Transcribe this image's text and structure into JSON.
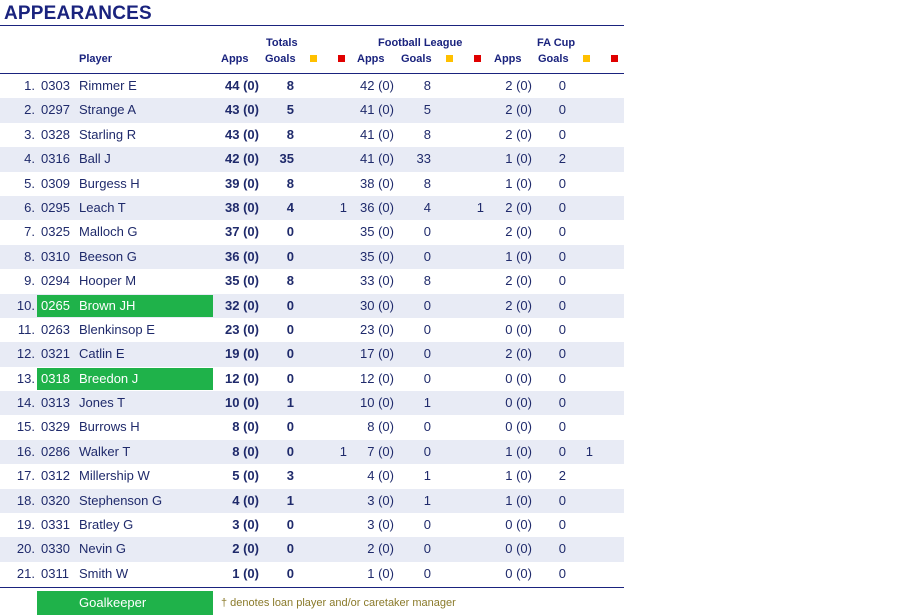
{
  "title": "APPEARANCES",
  "headers": {
    "player": "Player",
    "totals": "Totals",
    "football_league": "Football League",
    "fa_cup": "FA Cup",
    "apps": "Apps",
    "goals": "Goals"
  },
  "colors": {
    "goalkeeper": "#1fb24a",
    "yellow_card": "#ffc000",
    "red_card": "#e00000",
    "text": "#1a237e"
  },
  "rows": [
    {
      "pos": "1.",
      "code": "0303",
      "name": "Rimmer E",
      "gk": false,
      "tot_apps": "44 (0)",
      "tot_goals": "8",
      "tot_yel": "",
      "fl_apps": "42 (0)",
      "fl_goals": "8",
      "fl_yel": "",
      "fa_apps": "2 (0)",
      "fa_goals": "0",
      "fa_yel": ""
    },
    {
      "pos": "2.",
      "code": "0297",
      "name": "Strange A",
      "gk": false,
      "tot_apps": "43 (0)",
      "tot_goals": "5",
      "tot_yel": "",
      "fl_apps": "41 (0)",
      "fl_goals": "5",
      "fl_yel": "",
      "fa_apps": "2 (0)",
      "fa_goals": "0",
      "fa_yel": ""
    },
    {
      "pos": "3.",
      "code": "0328",
      "name": "Starling R",
      "gk": false,
      "tot_apps": "43 (0)",
      "tot_goals": "8",
      "tot_yel": "",
      "fl_apps": "41 (0)",
      "fl_goals": "8",
      "fl_yel": "",
      "fa_apps": "2 (0)",
      "fa_goals": "0",
      "fa_yel": ""
    },
    {
      "pos": "4.",
      "code": "0316",
      "name": "Ball J",
      "gk": false,
      "tot_apps": "42 (0)",
      "tot_goals": "35",
      "tot_yel": "",
      "fl_apps": "41 (0)",
      "fl_goals": "33",
      "fl_yel": "",
      "fa_apps": "1 (0)",
      "fa_goals": "2",
      "fa_yel": ""
    },
    {
      "pos": "5.",
      "code": "0309",
      "name": "Burgess H",
      "gk": false,
      "tot_apps": "39 (0)",
      "tot_goals": "8",
      "tot_yel": "",
      "fl_apps": "38 (0)",
      "fl_goals": "8",
      "fl_yel": "",
      "fa_apps": "1 (0)",
      "fa_goals": "0",
      "fa_yel": ""
    },
    {
      "pos": "6.",
      "code": "0295",
      "name": "Leach T",
      "gk": false,
      "tot_apps": "38 (0)",
      "tot_goals": "4",
      "tot_yel": "1",
      "fl_apps": "36 (0)",
      "fl_goals": "4",
      "fl_yel": "1",
      "fa_apps": "2 (0)",
      "fa_goals": "0",
      "fa_yel": ""
    },
    {
      "pos": "7.",
      "code": "0325",
      "name": "Malloch G",
      "gk": false,
      "tot_apps": "37 (0)",
      "tot_goals": "0",
      "tot_yel": "",
      "fl_apps": "35 (0)",
      "fl_goals": "0",
      "fl_yel": "",
      "fa_apps": "2 (0)",
      "fa_goals": "0",
      "fa_yel": ""
    },
    {
      "pos": "8.",
      "code": "0310",
      "name": "Beeson G",
      "gk": false,
      "tot_apps": "36 (0)",
      "tot_goals": "0",
      "tot_yel": "",
      "fl_apps": "35 (0)",
      "fl_goals": "0",
      "fl_yel": "",
      "fa_apps": "1 (0)",
      "fa_goals": "0",
      "fa_yel": ""
    },
    {
      "pos": "9.",
      "code": "0294",
      "name": "Hooper M",
      "gk": false,
      "tot_apps": "35 (0)",
      "tot_goals": "8",
      "tot_yel": "",
      "fl_apps": "33 (0)",
      "fl_goals": "8",
      "fl_yel": "",
      "fa_apps": "2 (0)",
      "fa_goals": "0",
      "fa_yel": ""
    },
    {
      "pos": "10.",
      "code": "0265",
      "name": "Brown JH",
      "gk": true,
      "tot_apps": "32 (0)",
      "tot_goals": "0",
      "tot_yel": "",
      "fl_apps": "30 (0)",
      "fl_goals": "0",
      "fl_yel": "",
      "fa_apps": "2 (0)",
      "fa_goals": "0",
      "fa_yel": ""
    },
    {
      "pos": "11.",
      "code": "0263",
      "name": "Blenkinsop E",
      "gk": false,
      "tot_apps": "23 (0)",
      "tot_goals": "0",
      "tot_yel": "",
      "fl_apps": "23 (0)",
      "fl_goals": "0",
      "fl_yel": "",
      "fa_apps": "0 (0)",
      "fa_goals": "0",
      "fa_yel": ""
    },
    {
      "pos": "12.",
      "code": "0321",
      "name": "Catlin E",
      "gk": false,
      "tot_apps": "19 (0)",
      "tot_goals": "0",
      "tot_yel": "",
      "fl_apps": "17 (0)",
      "fl_goals": "0",
      "fl_yel": "",
      "fa_apps": "2 (0)",
      "fa_goals": "0",
      "fa_yel": ""
    },
    {
      "pos": "13.",
      "code": "0318",
      "name": "Breedon J",
      "gk": true,
      "tot_apps": "12 (0)",
      "tot_goals": "0",
      "tot_yel": "",
      "fl_apps": "12 (0)",
      "fl_goals": "0",
      "fl_yel": "",
      "fa_apps": "0 (0)",
      "fa_goals": "0",
      "fa_yel": ""
    },
    {
      "pos": "14.",
      "code": "0313",
      "name": "Jones T",
      "gk": false,
      "tot_apps": "10 (0)",
      "tot_goals": "1",
      "tot_yel": "",
      "fl_apps": "10 (0)",
      "fl_goals": "1",
      "fl_yel": "",
      "fa_apps": "0 (0)",
      "fa_goals": "0",
      "fa_yel": ""
    },
    {
      "pos": "15.",
      "code": "0329",
      "name": "Burrows H",
      "gk": false,
      "tot_apps": "8 (0)",
      "tot_goals": "0",
      "tot_yel": "",
      "fl_apps": "8 (0)",
      "fl_goals": "0",
      "fl_yel": "",
      "fa_apps": "0 (0)",
      "fa_goals": "0",
      "fa_yel": ""
    },
    {
      "pos": "16.",
      "code": "0286",
      "name": "Walker T",
      "gk": false,
      "tot_apps": "8 (0)",
      "tot_goals": "0",
      "tot_yel": "1",
      "fl_apps": "7 (0)",
      "fl_goals": "0",
      "fl_yel": "",
      "fa_apps": "1 (0)",
      "fa_goals": "0",
      "fa_yel": "1"
    },
    {
      "pos": "17.",
      "code": "0312",
      "name": "Millership W",
      "gk": false,
      "tot_apps": "5 (0)",
      "tot_goals": "3",
      "tot_yel": "",
      "fl_apps": "4 (0)",
      "fl_goals": "1",
      "fl_yel": "",
      "fa_apps": "1 (0)",
      "fa_goals": "2",
      "fa_yel": ""
    },
    {
      "pos": "18.",
      "code": "0320",
      "name": "Stephenson G",
      "gk": false,
      "tot_apps": "4 (0)",
      "tot_goals": "1",
      "tot_yel": "",
      "fl_apps": "3 (0)",
      "fl_goals": "1",
      "fl_yel": "",
      "fa_apps": "1 (0)",
      "fa_goals": "0",
      "fa_yel": ""
    },
    {
      "pos": "19.",
      "code": "0331",
      "name": "Bratley G",
      "gk": false,
      "tot_apps": "3 (0)",
      "tot_goals": "0",
      "tot_yel": "",
      "fl_apps": "3 (0)",
      "fl_goals": "0",
      "fl_yel": "",
      "fa_apps": "0 (0)",
      "fa_goals": "0",
      "fa_yel": ""
    },
    {
      "pos": "20.",
      "code": "0330",
      "name": "Nevin G",
      "gk": false,
      "tot_apps": "2 (0)",
      "tot_goals": "0",
      "tot_yel": "",
      "fl_apps": "2 (0)",
      "fl_goals": "0",
      "fl_yel": "",
      "fa_apps": "0 (0)",
      "fa_goals": "0",
      "fa_yel": ""
    },
    {
      "pos": "21.",
      "code": "0311",
      "name": "Smith W",
      "gk": false,
      "tot_apps": "1 (0)",
      "tot_goals": "0",
      "tot_yel": "",
      "fl_apps": "1 (0)",
      "fl_goals": "0",
      "fl_yel": "",
      "fa_apps": "0 (0)",
      "fa_goals": "0",
      "fa_yel": ""
    }
  ],
  "legend": {
    "goalkeeper": "Goalkeeper",
    "loan_note": "† denotes loan player and/or caretaker manager"
  }
}
